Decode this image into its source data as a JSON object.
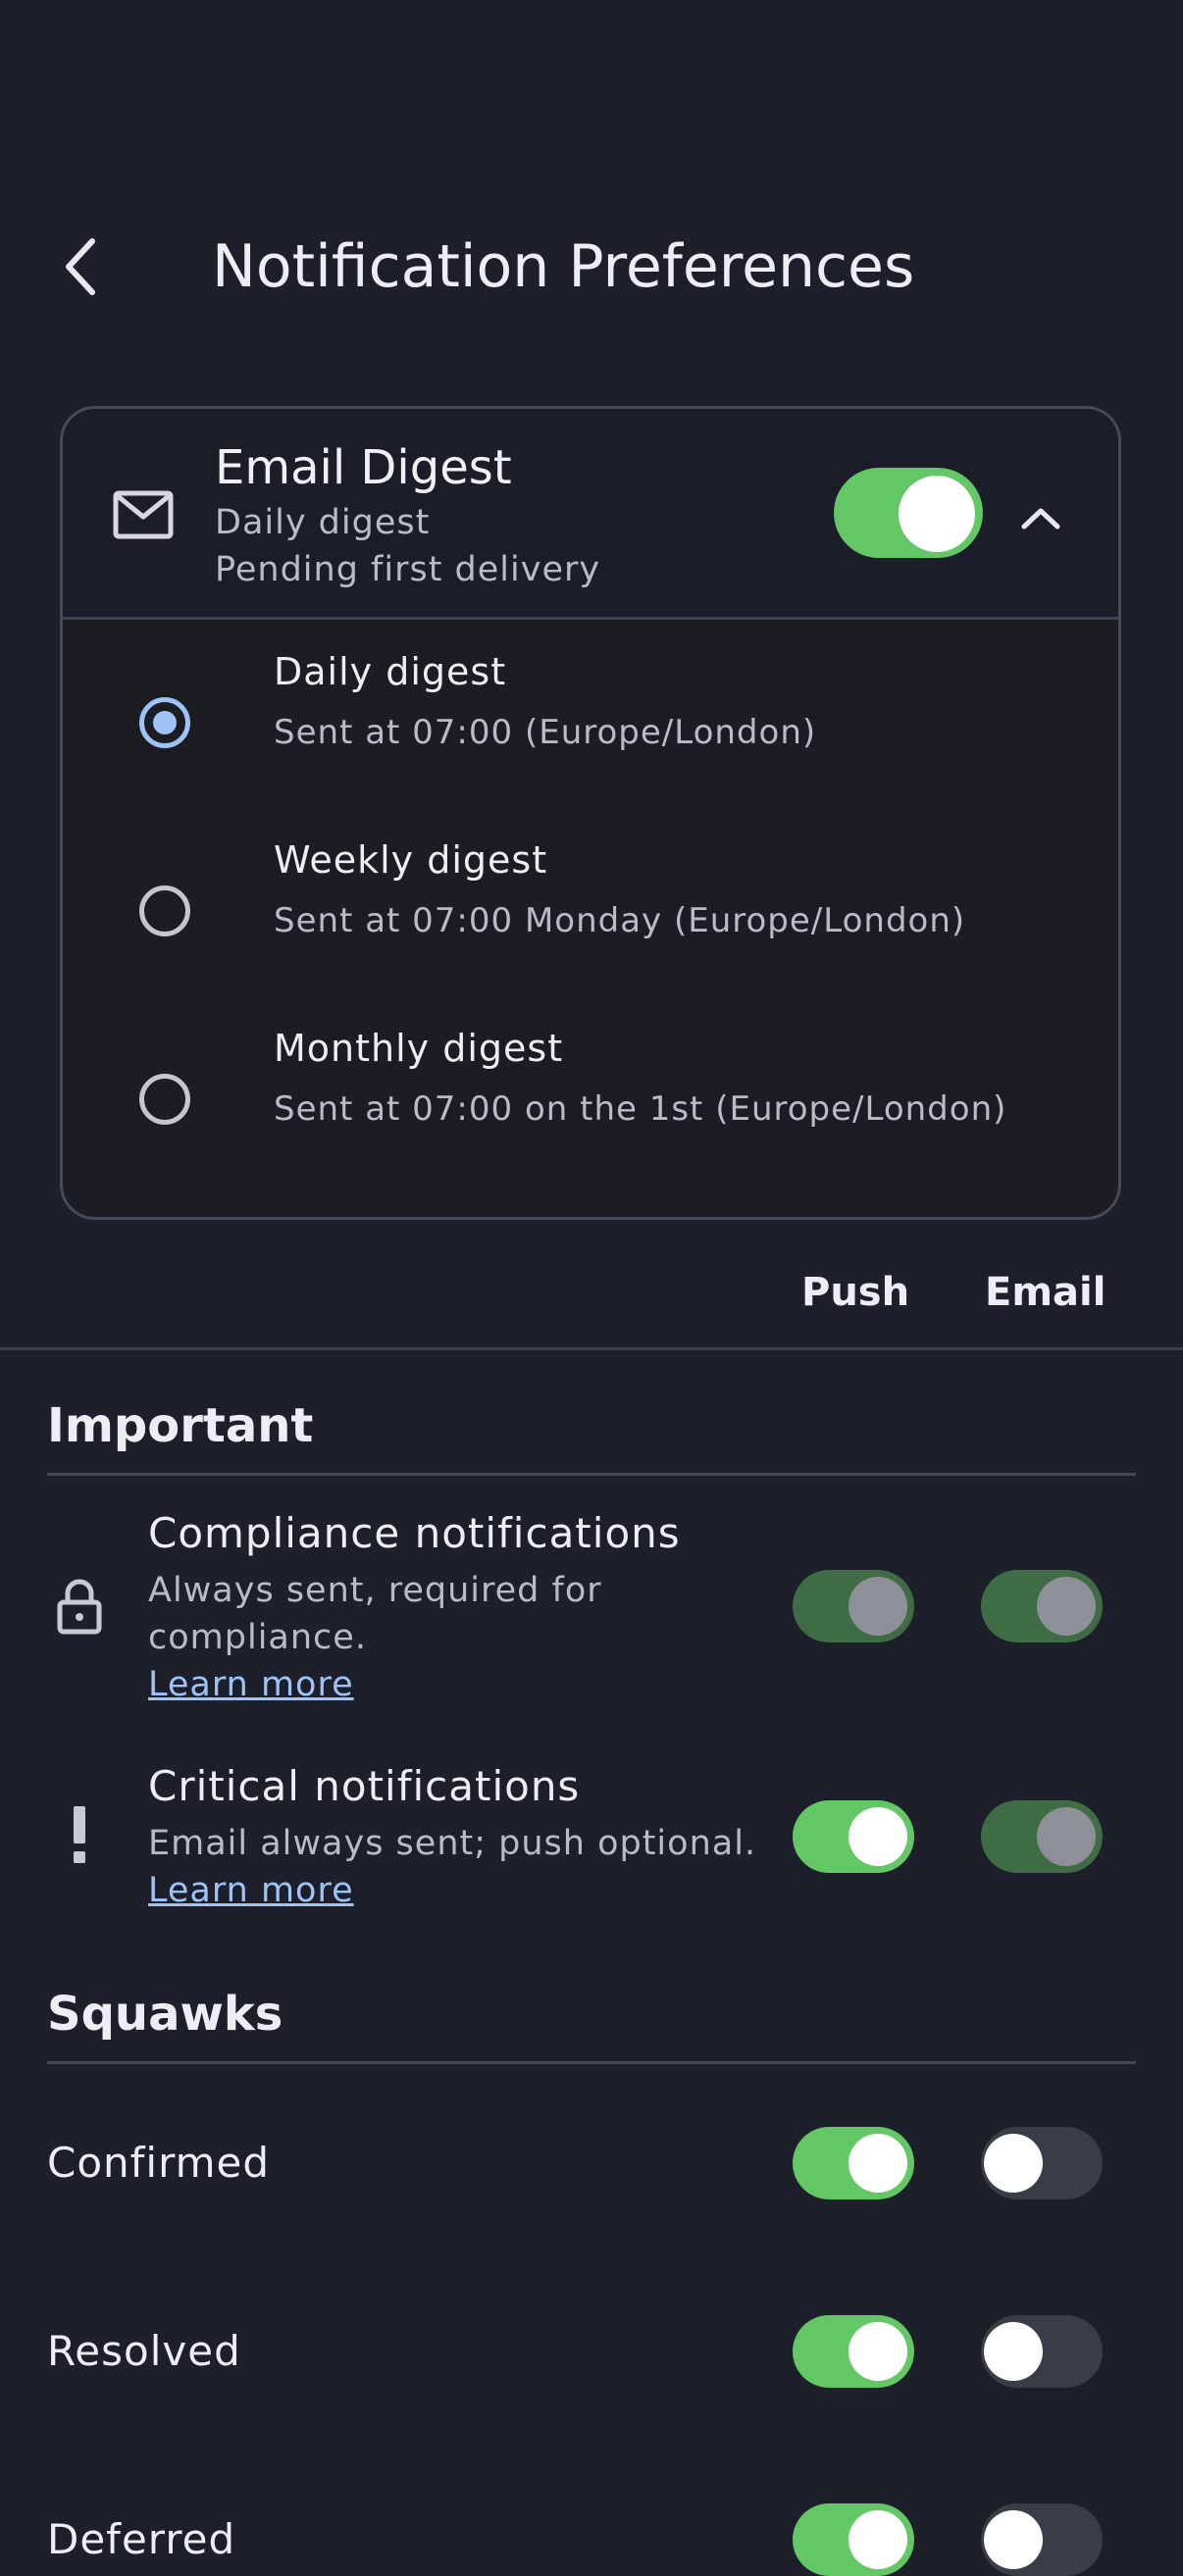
{
  "header": {
    "title": "Notification Preferences"
  },
  "digest": {
    "title": "Email Digest",
    "subtitle": "Daily digest",
    "status": "Pending first delivery",
    "enabled": true,
    "options": [
      {
        "title": "Daily digest",
        "desc": "Sent at 07:00 (Europe/London)",
        "selected": true
      },
      {
        "title": "Weekly digest",
        "desc": "Sent at 07:00 Monday (Europe/London)",
        "selected": false
      },
      {
        "title": "Monthly digest",
        "desc": "Sent at 07:00 on the 1st (Europe/London)",
        "selected": false
      }
    ]
  },
  "columns": {
    "push": "Push",
    "email": "Email"
  },
  "sections": {
    "important": {
      "title": "Important",
      "compliance": {
        "title": "Compliance notifications",
        "desc_line1": "Always sent, required for",
        "desc_line2": "compliance.",
        "link": "Learn more",
        "push": "locked-on",
        "email": "locked-on"
      },
      "critical": {
        "title": "Critical notifications",
        "desc": "Email always sent; push optional.",
        "link": "Learn more",
        "push": "on",
        "email": "locked-on"
      }
    },
    "squawks": {
      "title": "Squawks",
      "rows": [
        {
          "label": "Confirmed",
          "push": "on",
          "email": "off"
        },
        {
          "label": "Resolved",
          "push": "on",
          "email": "off"
        },
        {
          "label": "Deferred",
          "push": "on",
          "email": "off"
        }
      ]
    }
  },
  "colors": {
    "background": "#1d202b",
    "toggle_on": "#62c764",
    "toggle_locked": "#3f6c44",
    "accent_link": "#9fc3f5"
  }
}
